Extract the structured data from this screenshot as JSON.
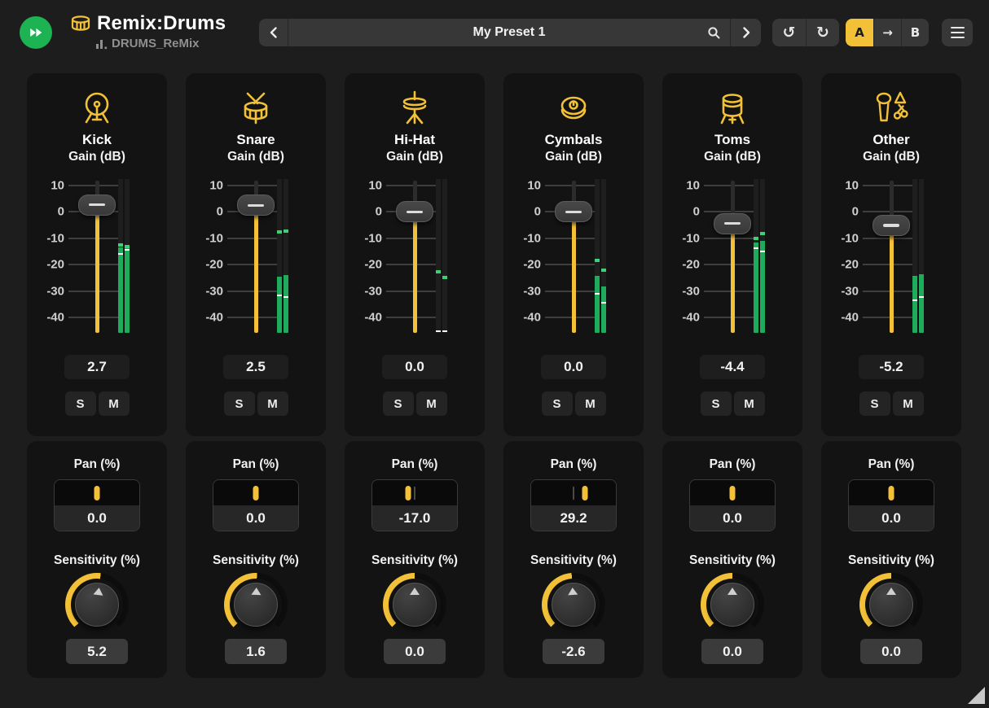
{
  "header": {
    "title": "Remix:Drums",
    "subtitle": "DRUMS_ReMix",
    "preset_name": "My Preset 1",
    "undo_icon": "↺",
    "redo_icon": "↻",
    "ab": {
      "a": "A",
      "arrow": "→",
      "b": "B",
      "active_slot": "A"
    }
  },
  "labels": {
    "gain": "Gain (dB)",
    "pan": "Pan (%)",
    "sensitivity": "Sensitivity (%)",
    "solo": "S",
    "mute": "M"
  },
  "scale": [
    {
      "label": "10",
      "value": 10
    },
    {
      "label": "0",
      "value": 0
    },
    {
      "label": "-10",
      "value": -10
    },
    {
      "label": "-20",
      "value": -20
    },
    {
      "label": "-30",
      "value": -30
    },
    {
      "label": "-40",
      "value": -40
    }
  ],
  "colors": {
    "accent": "#f2c137",
    "meter_green": "#1fab5c",
    "meter_peak": "#3ed077",
    "logo_green": "#1db353"
  },
  "channels": [
    {
      "name": "Kick",
      "icon": "kick-drum",
      "gain": "2.7",
      "gain_db": 2.7,
      "pan": "0.0",
      "pan_value": 0,
      "sensitivity": "5.2",
      "sensitivity_value": 5.2,
      "meter": {
        "left": {
          "level": -13.4,
          "avg": -16.0,
          "peak": -12.6
        },
        "right": {
          "level": -13.8,
          "avg": -14.4,
          "peak": -13.0
        }
      }
    },
    {
      "name": "Snare",
      "icon": "snare-drum",
      "gain": "2.5",
      "gain_db": 2.5,
      "pan": "0.0",
      "pan_value": 0,
      "sensitivity": "1.6",
      "sensitivity_value": 1.6,
      "meter": {
        "left": {
          "level": -24.5,
          "avg": -31.8,
          "peak": -7.5
        },
        "right": {
          "level": -23.8,
          "avg": -32.4,
          "peak": -7.2
        }
      }
    },
    {
      "name": "Hi-Hat",
      "icon": "hi-hat",
      "gain": "0.0",
      "gain_db": 0,
      "pan": "-17.0",
      "pan_value": -17,
      "sensitivity": "0.0",
      "sensitivity_value": 0,
      "meter": {
        "left": {
          "level": null,
          "avg": -45.2,
          "peak": -22.6
        },
        "right": {
          "level": null,
          "avg": -45.2,
          "peak": -25.0
        }
      }
    },
    {
      "name": "Cymbals",
      "icon": "cymbal",
      "gain": "0.0",
      "gain_db": 0,
      "pan": "29.2",
      "pan_value": 29.2,
      "sensitivity": "-2.6",
      "sensitivity_value": -2.6,
      "meter": {
        "left": {
          "level": -24.4,
          "avg": -31.1,
          "peak": -18.5
        },
        "right": {
          "level": -28.2,
          "avg": -34.4,
          "peak": -22.1
        }
      }
    },
    {
      "name": "Toms",
      "icon": "tom-drum",
      "gain": "-4.4",
      "gain_db": -4.4,
      "pan": "0.0",
      "pan_value": 0,
      "sensitivity": "0.0",
      "sensitivity_value": 0,
      "meter": {
        "left": {
          "level": -11.6,
          "avg": -13.9,
          "peak": -10.2
        },
        "right": {
          "level": -10.9,
          "avg": -15.1,
          "peak": -8.3
        }
      }
    },
    {
      "name": "Other",
      "icon": "percussion",
      "gain": "-5.2",
      "gain_db": -5.2,
      "pan": "0.0",
      "pan_value": 0,
      "sensitivity": "0.0",
      "sensitivity_value": 0,
      "meter": {
        "left": {
          "level": -24.4,
          "avg": -33.6,
          "peak": null
        },
        "right": {
          "level": -23.7,
          "avg": -32.2,
          "peak": null
        }
      }
    }
  ]
}
